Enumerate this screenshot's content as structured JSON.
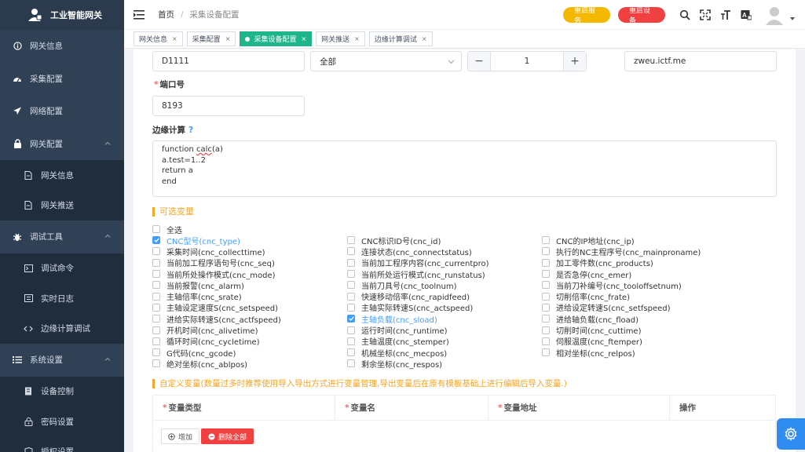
{
  "brand": {
    "title": "工业智能网关"
  },
  "sidebar": {
    "items": [
      {
        "label": "网关信息",
        "icon": "info-icon"
      },
      {
        "label": "采集配置",
        "icon": "dashboard-icon"
      },
      {
        "label": "网络配置",
        "icon": "send-icon"
      },
      {
        "label": "网关配置",
        "icon": "lock-icon",
        "expandable": true
      },
      {
        "label": "网关信息",
        "icon": "document-icon",
        "sub": true
      },
      {
        "label": "网关推送",
        "icon": "document-icon",
        "sub": true
      },
      {
        "label": "调试工具",
        "icon": "bug-icon",
        "expandable": true
      },
      {
        "label": "调试命令",
        "icon": "terminal-icon",
        "sub": true
      },
      {
        "label": "实时日志",
        "icon": "log-icon",
        "sub": true
      },
      {
        "label": "边缘计算调试",
        "icon": "code-icon",
        "sub": true
      },
      {
        "label": "系统设置",
        "icon": "list-icon",
        "expandable": true
      },
      {
        "label": "设备控制",
        "icon": "device-icon",
        "sub": true
      },
      {
        "label": "密码设置",
        "icon": "key-icon",
        "sub": true
      },
      {
        "label": "授权设置",
        "icon": "shield-icon",
        "sub": true
      }
    ]
  },
  "header": {
    "breadcrumb_home": "首页",
    "breadcrumb_current": "采集设备配置",
    "restart_service": "重启服务",
    "restart_device": "重启设备"
  },
  "tags": [
    {
      "label": "网关信息",
      "active": false
    },
    {
      "label": "采集配置",
      "active": false
    },
    {
      "label": "采集设备配置",
      "active": true
    },
    {
      "label": "网关推送",
      "active": false
    },
    {
      "label": "边缘计算调试",
      "active": false
    }
  ],
  "form": {
    "address_value": "D1111",
    "select_value": "全部",
    "stepper_value": "1",
    "host_value": "zweu.ictf.me",
    "port_label": "端口号",
    "port_value": "8193",
    "edge_label": "边缘计算",
    "edge_help": "?",
    "code_lines": [
      "function calc(a)",
      "a.test=1..2",
      "return a",
      "end"
    ]
  },
  "variables": {
    "title": "可选变量",
    "select_all": "全选",
    "items": [
      {
        "label": "CNC型号(cnc_type)",
        "checked": true
      },
      {
        "label": "CNC标识ID号(cnc_id)",
        "checked": false
      },
      {
        "label": "CNC的IP地址(cnc_ip)",
        "checked": false
      },
      {
        "label": "采集时间(cnc_collecttime)",
        "checked": false
      },
      {
        "label": "连接状态(cnc_connectstatus)",
        "checked": false
      },
      {
        "label": "执行的NC主程序号(cnc_mainproname)",
        "checked": false
      },
      {
        "label": "当前加工程序语句号(cnc_seq)",
        "checked": false
      },
      {
        "label": "当前加工程序内容(cnc_currentpro)",
        "checked": false
      },
      {
        "label": "加工零件数(cnc_products)",
        "checked": false
      },
      {
        "label": "当前所处操作模式(cnc_mode)",
        "checked": false
      },
      {
        "label": "当前所处运行模式(cnc_runstatus)",
        "checked": false
      },
      {
        "label": "是否急停(cnc_emer)",
        "checked": false
      },
      {
        "label": "当前报警(cnc_alarm)",
        "checked": false
      },
      {
        "label": "当前刀具号(cnc_toolnum)",
        "checked": false
      },
      {
        "label": "当前刀补编号(cnc_tooloffsetnum)",
        "checked": false
      },
      {
        "label": "主轴倍率(cnc_srate)",
        "checked": false
      },
      {
        "label": "快速移动倍率(cnc_rapidfeed)",
        "checked": false
      },
      {
        "label": "切削倍率(cnc_frate)",
        "checked": false
      },
      {
        "label": "主轴设定速度S(cnc_setspeed)",
        "checked": false
      },
      {
        "label": "主轴实际转速S(cnc_actspeed)",
        "checked": false
      },
      {
        "label": "进给设定转速S(cnc_setfspeed)",
        "checked": false
      },
      {
        "label": "进给实际转速S(cnc_actfspeed)",
        "checked": false
      },
      {
        "label": "主轴负载(cnc_sload)",
        "checked": true
      },
      {
        "label": "进给轴负载(cnc_fload)",
        "checked": false
      },
      {
        "label": "开机时间(cnc_alivetime)",
        "checked": false
      },
      {
        "label": "运行时间(cnc_runtime)",
        "checked": false
      },
      {
        "label": "切削时间(cnc_cuttime)",
        "checked": false
      },
      {
        "label": "循环时间(cnc_cycletime)",
        "checked": false
      },
      {
        "label": "主轴温度(cnc_stemper)",
        "checked": false
      },
      {
        "label": "伺服温度(cnc_ftemper)",
        "checked": false
      },
      {
        "label": "G代码(cnc_gcode)",
        "checked": false
      },
      {
        "label": "机械坐标(cnc_mecpos)",
        "checked": false
      },
      {
        "label": "相对坐标(cnc_relpos)",
        "checked": false
      },
      {
        "label": "绝对坐标(cnc_ablpos)",
        "checked": false
      },
      {
        "label": "剩余坐标(cnc_respos)",
        "checked": false
      }
    ]
  },
  "custom": {
    "title": "自定义变量(数量过多时推荐使用导入导出方式进行变量管理,导出变量后在原有模板基础上进行编辑后导入变量.)",
    "headers": [
      "变量类型",
      "变量名",
      "变量地址",
      "操作"
    ],
    "add_label": "增加",
    "delete_all_label": "删除全部"
  },
  "colors": {
    "accent": "#409eff",
    "sidebar": "#304156",
    "tag_active": "#1fb58a",
    "warning": "#f5a623",
    "danger": "#f04040"
  }
}
